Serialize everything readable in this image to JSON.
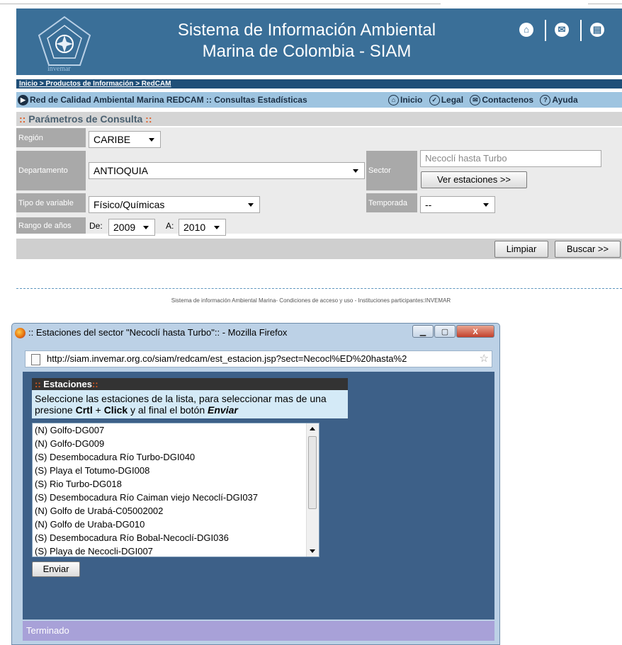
{
  "header": {
    "title_line1": "Sistema de Información Ambiental",
    "title_line2": "Marina de Colombia - SIAM",
    "logo_text": "invemar",
    "icons": [
      "home-icon",
      "mail-icon",
      "print-icon"
    ]
  },
  "breadcrumb": "Inicio > Productos de Información > RedCAM",
  "nav": {
    "section_title": "Red de Calidad Ambiental Marina REDCAM :: Consultas Estadísticas",
    "inicio": "Inicio",
    "legal": "Legal",
    "contactenos": "Contactenos",
    "ayuda": "Ayuda"
  },
  "params": {
    "header_prefix": "::",
    "header_text": " Parámetros de Consulta ",
    "header_suffix": "::",
    "region_label": "Región",
    "region_value": "CARIBE",
    "departamento_label": "Departamento",
    "departamento_value": "ANTIOQUIA",
    "sector_label": "Sector",
    "sector_value": "Necoclí hasta Turbo",
    "ver_estaciones": "Ver estaciones >>",
    "tipo_label": "Tipo de variable",
    "tipo_value": "Físico/Químicas",
    "temporada_label": "Temporada",
    "temporada_value": "--",
    "rango_label": "Rango de años",
    "de_label": "De:",
    "de_value": "2009",
    "a_label": "A:",
    "a_value": "2010",
    "limpiar": "Limpiar",
    "buscar": "Buscar >>"
  },
  "footer": "Sistema de información Ambiental Marina- Condiciones de acceso y uso - Instituciones participantes:INVEMAR",
  "popup": {
    "window_title": ":: Estaciones del sector \"Necoclí hasta Turbo\":: - Mozilla Firefox",
    "url": "http://siam.invemar.org.co/siam/redcam/est_estacion.jsp?sect=Necocl%ED%20hasta%2",
    "header_prefix": "::",
    "header_text": " Estaciones",
    "header_suffix": "::",
    "instr_line1": "Seleccione las estaciones de la lista, para seleccionar mas de una",
    "instr_a": "presione ",
    "instr_b": "Crtl",
    "instr_c": " + ",
    "instr_d": "Click",
    "instr_e": " y al final el botón ",
    "instr_f": "Enviar",
    "stations": [
      "(N) Golfo-DG007",
      "(N) Golfo-DG009",
      "(S) Desembocadura Río Turbo-DGI040",
      "(S) Playa el Totumo-DGI008",
      "(S) Rio Turbo-DG018",
      "(S) Desembocadura Río Caiman viejo Necoclí-DGI037",
      "(N) Golfo de Urabá-C05002002",
      "(N) Golfo de Uraba-DG010",
      "(S) Desembocadura Río Bobal-Necoclí-DGI036",
      "(S) Playa de Necocli-DGI007"
    ],
    "enviar": "Enviar",
    "status": "Terminado"
  }
}
